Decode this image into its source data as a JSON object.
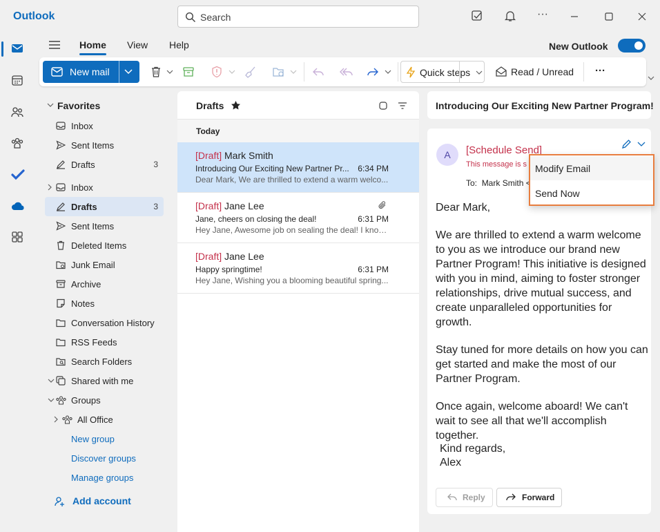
{
  "app": {
    "title": "Outlook"
  },
  "search": {
    "placeholder": "Search"
  },
  "ribbon": {
    "tabs": [
      "Home",
      "View",
      "Help"
    ],
    "new_outlook_label": "New Outlook",
    "new_outlook_on": true,
    "new_mail": "New mail",
    "quick_steps": "Quick steps",
    "read_unread": "Read / Unread"
  },
  "nav": {
    "favorites_header": "Favorites",
    "favorites": [
      {
        "label": "Inbox",
        "icon": "inbox-icon"
      },
      {
        "label": "Sent Items",
        "icon": "send-icon"
      },
      {
        "label": "Drafts",
        "icon": "pencil-icon",
        "count": "3"
      }
    ],
    "folders": [
      {
        "label": "Inbox",
        "icon": "inbox-icon"
      },
      {
        "label": "Drafts",
        "icon": "pencil-icon",
        "count": "3",
        "selected": true
      },
      {
        "label": "Sent Items",
        "icon": "send-icon"
      },
      {
        "label": "Deleted Items",
        "icon": "trash-icon"
      },
      {
        "label": "Junk Email",
        "icon": "junk-icon"
      },
      {
        "label": "Archive",
        "icon": "archive-icon"
      },
      {
        "label": "Notes",
        "icon": "note-icon"
      },
      {
        "label": "Conversation History",
        "icon": "folder-icon"
      },
      {
        "label": "RSS Feeds",
        "icon": "folder-icon"
      },
      {
        "label": "Search Folders",
        "icon": "search-folder-icon"
      },
      {
        "label": "Shared with me",
        "icon": "shared-icon"
      },
      {
        "label": "Groups",
        "icon": "groups-icon"
      },
      {
        "label": "All Office",
        "icon": "groups-icon"
      }
    ],
    "group_links": [
      "New group",
      "Discover groups",
      "Manage groups"
    ],
    "add_account": "Add account"
  },
  "list": {
    "title": "Drafts",
    "section": "Today",
    "messages": [
      {
        "draft_tag": "[Draft]",
        "sender": "Mark Smith",
        "subject": "Introducing Our Exciting New Partner Pr...",
        "time": "6:34 PM",
        "preview": "Dear Mark, We are thrilled to extend a warm welco...",
        "selected": true
      },
      {
        "draft_tag": "[Draft]",
        "sender": "Jane Lee",
        "subject": "Jane, cheers on closing the deal!",
        "time": "6:31 PM",
        "preview": "Hey Jane, Awesome job on sealing the deal! I know...",
        "attachment": true
      },
      {
        "draft_tag": "[Draft]",
        "sender": "Jane Lee",
        "subject": "Happy springtime!",
        "time": "6:31 PM",
        "preview": "Hey Jane, Wishing you a blooming beautiful spring..."
      }
    ]
  },
  "reading": {
    "subject": "Introducing Our Exciting New Partner Program!",
    "avatar_initial": "A",
    "schedule_label": "[Schedule Send]",
    "schedule_note": "This message is s",
    "to_label": "To:",
    "to_name": "Mark Smith",
    "to_suffix": "<",
    "greeting": "Dear Mark,",
    "para1": "We are thrilled to extend a warm welcome to you as we introduce our brand new Partner Program! This initiative is designed with you in mind, aiming to foster stronger relationships, drive mutual success, and create unparalleled opportunities for growth.",
    "para2": "Stay tuned for more details on how you can get started and make the most of our Partner Program.",
    "para3": "Once again, welcome aboard! We can't wait to see all that we'll accomplish together.",
    "closing": "Kind regards,",
    "signature": "Alex",
    "reply": "Reply",
    "forward": "Forward"
  },
  "menu": {
    "items": [
      "Modify Email",
      "Send Now"
    ]
  }
}
